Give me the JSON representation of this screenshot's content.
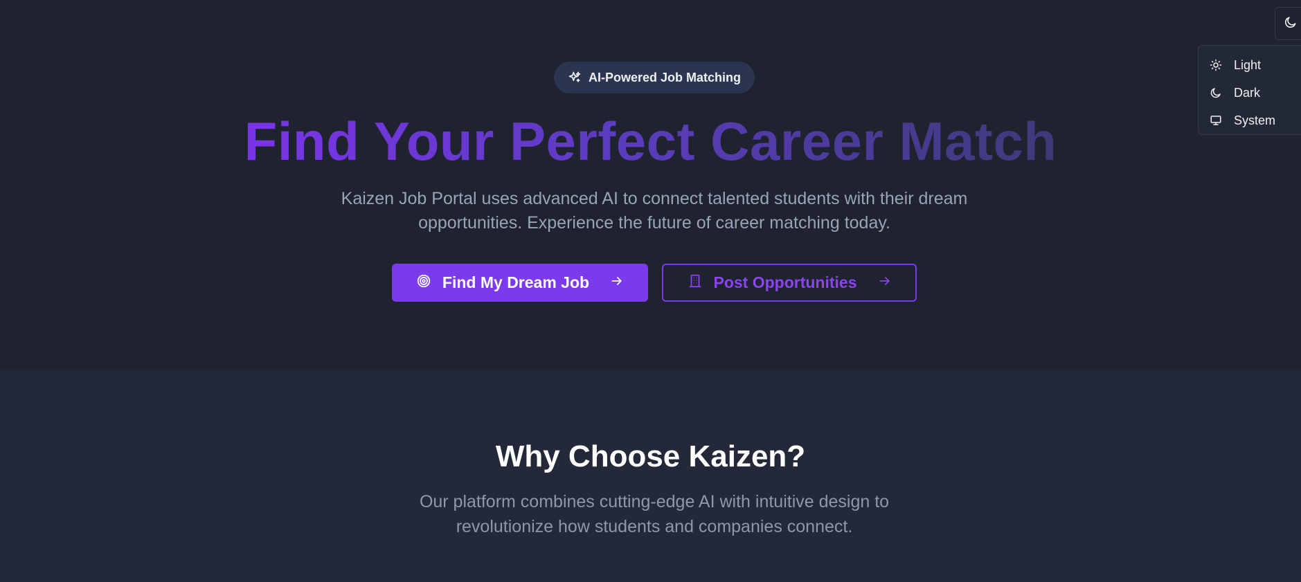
{
  "hero": {
    "badge_label": "AI-Powered Job Matching",
    "title": "Find Your Perfect Career Match",
    "subtitle": "Kaizen Job Portal uses advanced AI to connect talented students with their dream opportunities. Experience the future of career matching today.",
    "primary_button": {
      "label": "Find My Dream Job",
      "icon": "target-icon"
    },
    "secondary_button": {
      "label": "Post Opportunities",
      "icon": "building-icon"
    }
  },
  "why": {
    "title": "Why Choose Kaizen?",
    "subtitle": "Our platform combines cutting-edge AI with intuitive design to revolutionize how students and companies connect."
  },
  "theme_menu": {
    "toggle_icon": "moon-icon",
    "items": [
      {
        "label": "Light",
        "icon": "sun-icon"
      },
      {
        "label": "Dark",
        "icon": "moon-icon"
      },
      {
        "label": "System",
        "icon": "monitor-icon"
      }
    ]
  },
  "colors": {
    "accent": "#7c3aed",
    "background": "#1f222f",
    "section_background": "#232938",
    "muted_text": "#9aa3b8"
  }
}
